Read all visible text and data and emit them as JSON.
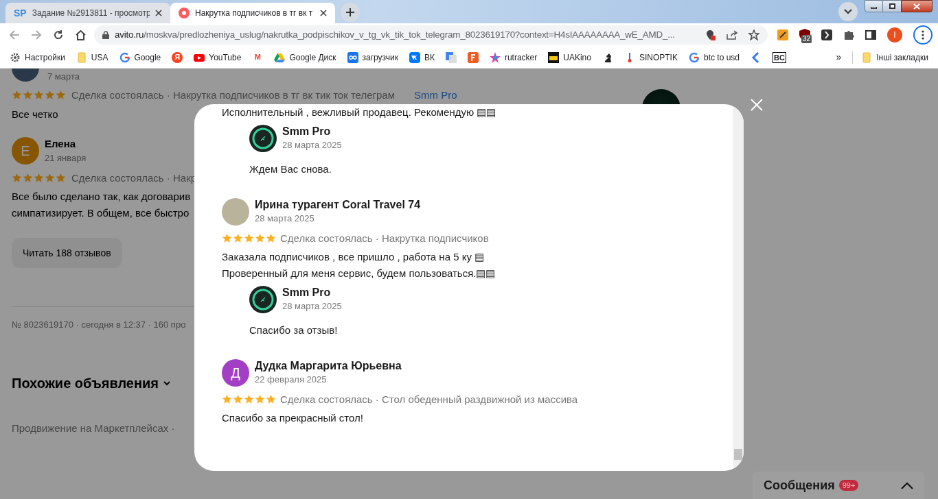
{
  "browser": {
    "tabs": [
      {
        "logo": "SP",
        "title": "Задание №2913811 - просмотр",
        "selected": false
      },
      {
        "title": "Накрутка подписчиков в тг вк т",
        "selected": true
      }
    ],
    "url_host": "avito.ru",
    "url_path": "/moskva/predlozheniya_uslug/nakrutka_podpischikov_v_tg_vk_tik_tok_telegram_8023619170?context=H4sIAAAAAAAA_wE_AMD_...",
    "extension_badge": "32",
    "profile_letter": "I",
    "bookmarks": [
      {
        "label": "Настройки"
      },
      {
        "label": "USA"
      },
      {
        "label": "Google"
      },
      {
        "label": "Я"
      },
      {
        "label": "YouTube"
      },
      {
        "label": "M"
      },
      {
        "label": "Google Диск"
      },
      {
        "label": "загрузчик"
      },
      {
        "label": "ВК"
      },
      {
        "label": "rutracker"
      },
      {
        "label": "UAKino"
      },
      {
        "label": "SINOPTIK"
      },
      {
        "label": "btc to usd"
      },
      {
        "label": "BC"
      }
    ],
    "more": "»",
    "other_bookmarks": "Інші закладки"
  },
  "page": {
    "first_review": {
      "date": "7 марта",
      "stars": 5,
      "deal": "Сделка состоялась · Накрутка подписчиков в тг вк тик ток телеграм",
      "seller": "Smm Pro",
      "text": "Все четко"
    },
    "second_review": {
      "letter": "Е",
      "author": "Елена",
      "date": "21 января",
      "stars": 5,
      "deal": "Сделка состоялась · Накр",
      "lines": [
        "Все было сделано так, как договарив",
        "симпатизирует. В общем, все быстро"
      ]
    },
    "read_all": "Читать 188 отзывов",
    "meta": "№ 8023619170 · сегодня в 12:37 · 160 про",
    "similar_title": "Похожие объявления",
    "similar_item": "Продвижение на Маркетплейсах ·"
  },
  "modal": {
    "reviews": [
      {
        "lines": [
          "Исполнительный , вежливый продавец. Рекомендую ▤▤"
        ],
        "reply": {
          "author": "Smm Pro",
          "date": "28 марта 2025",
          "text": "Ждем Вас снова."
        }
      },
      {
        "author": "Ирина турагент Coral Travel 74",
        "date": "28 марта 2025",
        "stars": 5,
        "deal": "Сделка состоялась · Накрутка подписчиков",
        "lines": [
          "Заказала подписчиков , все пришло , работа на 5 ку ▤",
          "Проверенный для меня сервис, будем пользоваться.▤▤"
        ],
        "reply": {
          "author": "Smm Pro",
          "date": "28 марта 2025",
          "text": "Спасибо за отзыв!"
        }
      },
      {
        "letter": "Д",
        "color": "#a33fc4",
        "author": "Дудка Маргарита Юрьевна",
        "date": "22 февраля 2025",
        "stars": 5,
        "deal": "Сделка состоялась · Стол обеденный раздвижной из массива",
        "lines": [
          "Спасибо за прекрасный стол!"
        ]
      }
    ]
  },
  "messages": {
    "label": "Сообщения",
    "badge": "99+"
  }
}
